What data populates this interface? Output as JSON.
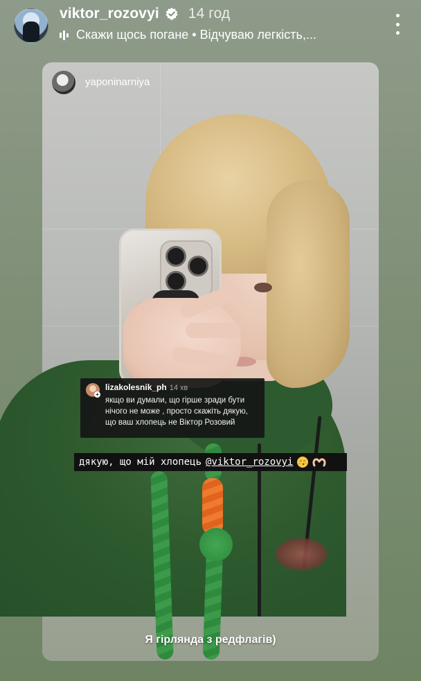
{
  "header": {
    "username": "viktor_rozovyi",
    "time": "14 год",
    "music": "Скажи щось погане • Відчуваю легкість,..."
  },
  "card": {
    "username": "yaponinarniya"
  },
  "comment": {
    "username": "lizakolesnik_ph",
    "time": "14 хв",
    "text": "якщо ви думали, що гірше зради бути нічого не може , просто скажіть дякую, що ваш хлопець не Віктор Розовий"
  },
  "caption": {
    "prefix": "дякую, що мій хлопець",
    "mention": "@viktor_rozovyi"
  },
  "bottom_caption": "Я гірлянда з редфлагів)",
  "colors": {
    "background": "#7f8f76",
    "hoodie": "#2e5a2e",
    "rope_green": "#3c9a4a",
    "rope_orange": "#f07a2e",
    "verified": "#ffffff"
  },
  "icons": {
    "verified": "verified-badge-icon",
    "music": "equalizer-icon",
    "more": "more-vertical-icon"
  }
}
